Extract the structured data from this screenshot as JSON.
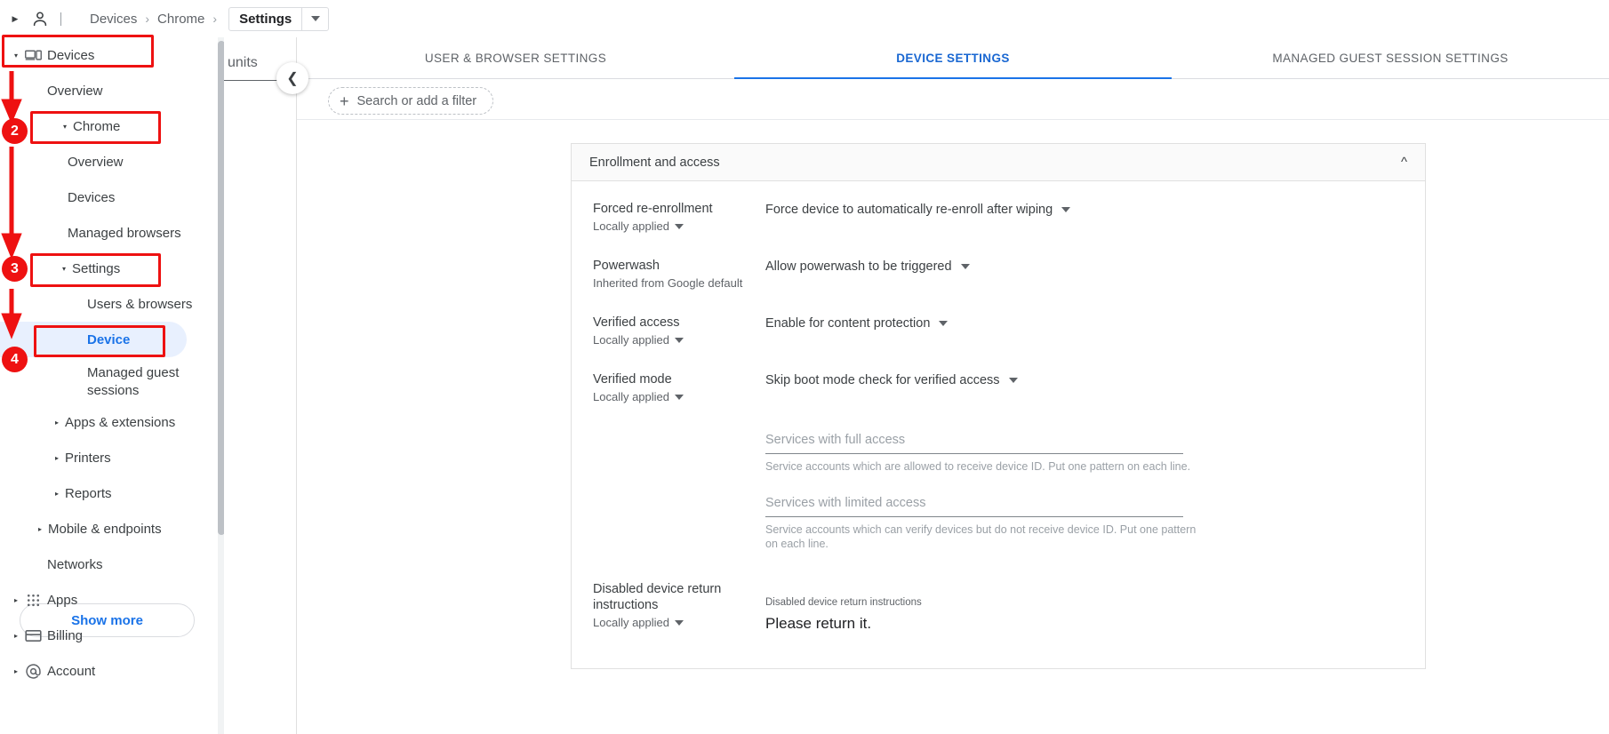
{
  "header": {
    "expand_icon": "triangle-right-icon",
    "person_icon": "person-icon",
    "breadcrumb": [
      {
        "label": "Devices"
      },
      {
        "label": "Chrome"
      }
    ],
    "breadcrumb_separator": "›",
    "current_chip": "Settings",
    "chip_caret_icon": "chevron-down-icon"
  },
  "sidebar": {
    "items": [
      {
        "label": "Devices",
        "icon": "devices-icon",
        "level": 0,
        "expand": "▾",
        "selected": false
      },
      {
        "label": "Overview",
        "icon": "",
        "level": 1,
        "expand": "",
        "selected": false
      },
      {
        "label": "Chrome",
        "icon": "",
        "level": 1,
        "expand": "▾",
        "selected": false
      },
      {
        "label": "Overview",
        "icon": "",
        "level": 2,
        "expand": "",
        "selected": false
      },
      {
        "label": "Devices",
        "icon": "",
        "level": 2,
        "expand": "",
        "selected": false
      },
      {
        "label": "Managed browsers",
        "icon": "",
        "level": 2,
        "expand": "",
        "selected": false
      },
      {
        "label": "Settings",
        "icon": "",
        "level": 2,
        "expand": "▾",
        "selected": false
      },
      {
        "label": "Users & browsers",
        "icon": "",
        "level": 3,
        "expand": "",
        "selected": false
      },
      {
        "label": "Device",
        "icon": "",
        "level": 3,
        "expand": "",
        "selected": true
      },
      {
        "label": "Managed guest sessions",
        "icon": "",
        "level": 3,
        "expand": "",
        "selected": false
      },
      {
        "label": "Apps & extensions",
        "icon": "",
        "level": 2,
        "expand": "▸",
        "selected": false
      },
      {
        "label": "Printers",
        "icon": "",
        "level": 2,
        "expand": "▸",
        "selected": false
      },
      {
        "label": "Reports",
        "icon": "",
        "level": 2,
        "expand": "▸",
        "selected": false
      },
      {
        "label": "Mobile & endpoints",
        "icon": "",
        "level": 1,
        "expand": "▸",
        "selected": false
      },
      {
        "label": "Networks",
        "icon": "",
        "level": 1,
        "expand": "",
        "selected": false
      },
      {
        "label": "Apps",
        "icon": "apps-grid-icon",
        "level": 0,
        "expand": "▸",
        "selected": false
      },
      {
        "label": "Billing",
        "icon": "billing-icon",
        "level": 0,
        "expand": "▸",
        "selected": false
      },
      {
        "label": "Account",
        "icon": "account-at-icon",
        "level": 0,
        "expand": "▸",
        "selected": false
      }
    ],
    "show_more": "Show more"
  },
  "ou_panel": {
    "title_visible_fragment": "units",
    "collapse_icon": "chevron-left-icon"
  },
  "tabs": [
    {
      "label": "USER & BROWSER SETTINGS",
      "active": false
    },
    {
      "label": "DEVICE SETTINGS",
      "active": true
    },
    {
      "label": "MANAGED GUEST SESSION SETTINGS",
      "active": false
    }
  ],
  "filter": {
    "placeholder": "Search or add a filter",
    "add_icon": "plus-icon"
  },
  "card": {
    "title": "Enrollment and access",
    "collapse_icon": "chevron-up-icon",
    "settings": [
      {
        "label": "Forced re-enrollment",
        "scope": "Locally applied",
        "scope_has_caret": true,
        "value": "Force device to automatically re-enroll after wiping"
      },
      {
        "label": "Powerwash",
        "scope": "Inherited from Google default",
        "scope_has_caret": false,
        "value": "Allow powerwash to be triggered"
      },
      {
        "label": "Verified access",
        "scope": "Locally applied",
        "scope_has_caret": true,
        "value": "Enable for content protection"
      },
      {
        "label": "Verified mode",
        "scope": "Locally applied",
        "scope_has_caret": true,
        "value": "Skip boot mode check for verified access"
      }
    ],
    "fields": [
      {
        "placeholder": "Services with full access",
        "help": "Service accounts which are allowed to receive device ID. Put one pattern on each line."
      },
      {
        "placeholder": "Services with limited access",
        "help": "Service accounts which can verify devices but do not receive device ID. Put one pattern on each line."
      }
    ],
    "return_instructions": {
      "label": "Disabled device return instructions",
      "scope": "Locally applied",
      "field_label": "Disabled device return instructions",
      "value": "Please return it."
    }
  },
  "annotations": {
    "badges": [
      {
        "num": "2"
      },
      {
        "num": "3"
      },
      {
        "num": "4"
      }
    ]
  },
  "colors": {
    "accent": "#1a73e8",
    "selected_bg": "#e8f0fe",
    "annotation": "#ee1111",
    "text": "#3c4043",
    "muted": "#5f6368"
  }
}
